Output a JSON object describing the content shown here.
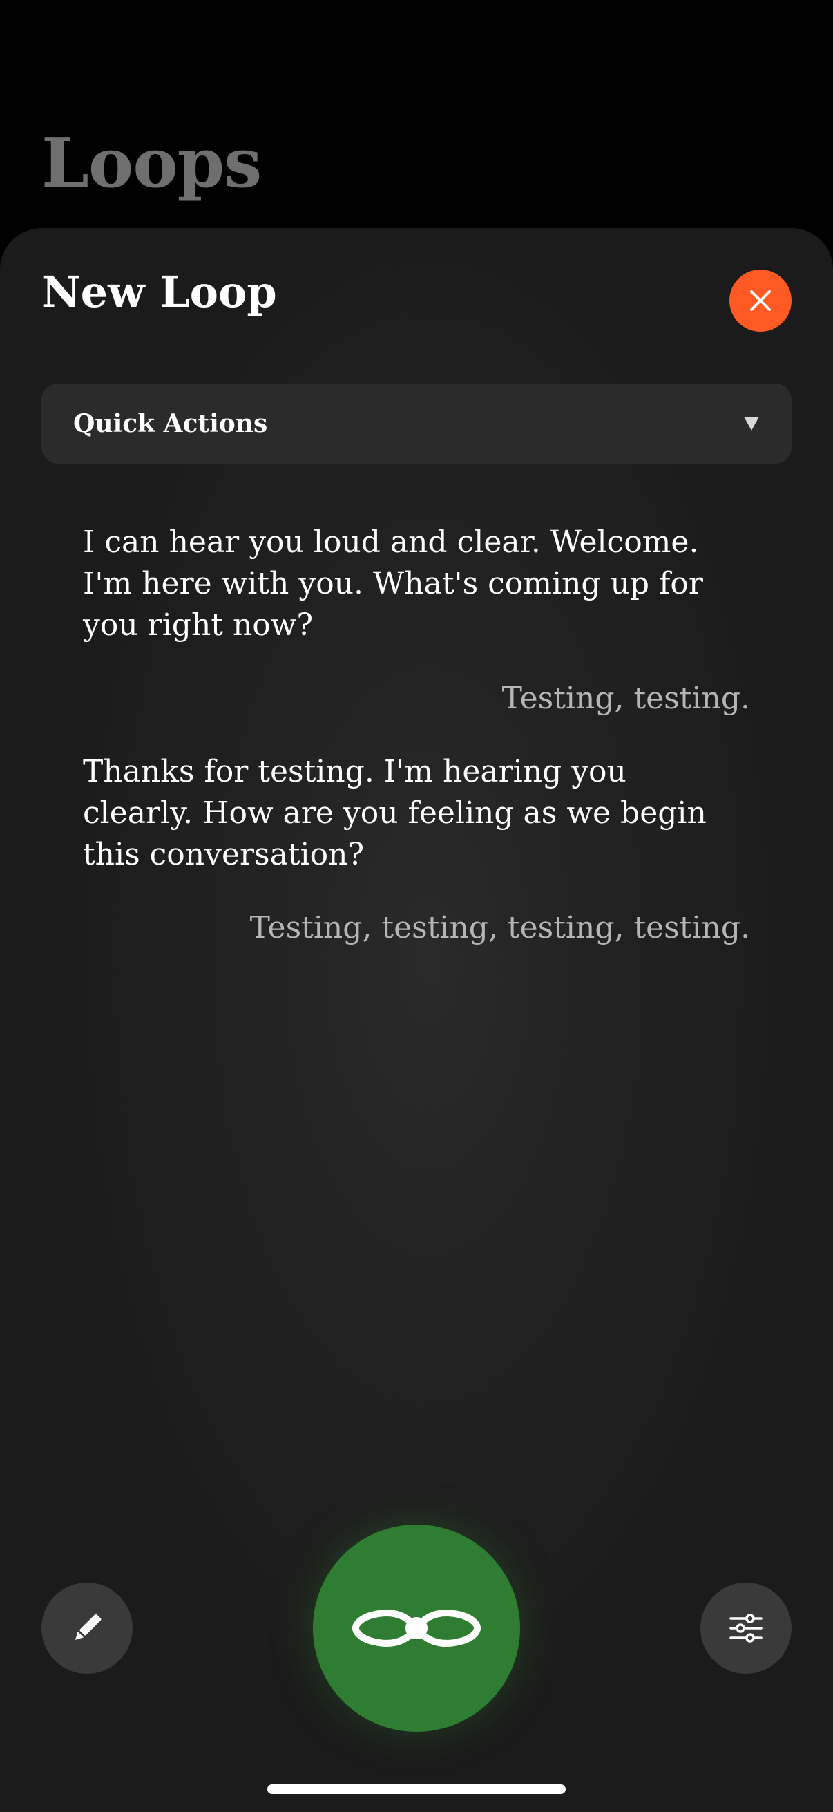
{
  "background": {
    "title": "Loops"
  },
  "sheet": {
    "title": "New Loop",
    "close_icon": "close-icon",
    "accent_color": "#ff5a24"
  },
  "quick_actions": {
    "label": "Quick Actions",
    "icon": "dropdown-triangle-icon"
  },
  "messages": [
    {
      "role": "assistant",
      "text": "I can hear you loud and clear. Welcome. I'm here with you. What's coming up for you right now?"
    },
    {
      "role": "user",
      "text": "Testing, testing."
    },
    {
      "role": "assistant",
      "text": "Thanks for testing. I'm hearing you clearly. How are you feeling as we begin this conversation?"
    },
    {
      "role": "user",
      "text": "Testing, testing, testing, testing."
    }
  ],
  "controls": {
    "edit_icon": "pencil-icon",
    "loop_icon": "infinity-loop-icon",
    "settings_icon": "sliders-icon",
    "loop_color": "#2f7d32"
  }
}
